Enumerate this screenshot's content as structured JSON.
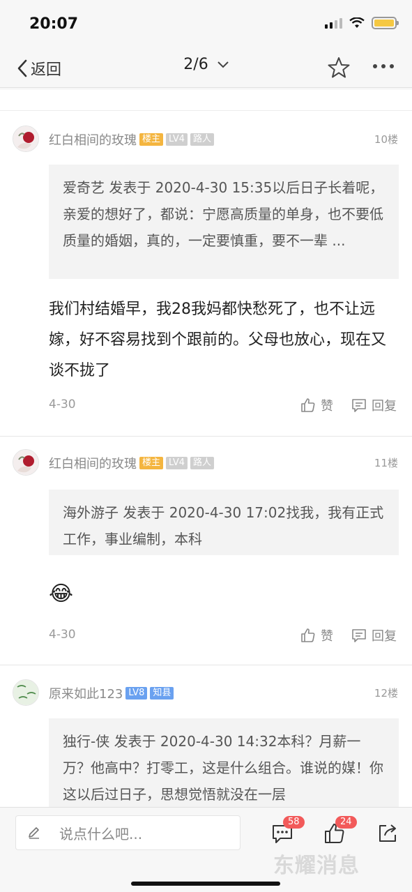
{
  "status": {
    "time": "20:07"
  },
  "nav": {
    "back_label": "返回",
    "page_indicator": "2/6"
  },
  "posts": [
    {
      "author": "红白相间的玫瑰",
      "badges": [
        "楼主",
        "LV4",
        "路人"
      ],
      "floor": "10楼",
      "quote": "爱奇艺 发表于 2020-4-30 15:35以后日子长着呢，亲爱的想好了，都说：宁愿高质量的单身，也不要低质量的婚姻，真的，一定要慎重，要不一辈 ...",
      "content": "我们村结婚早，我28我妈都快愁死了，也不让远嫁，好不容易找到个跟前的。父母也放心，现在又谈不拢了",
      "date": "4-30",
      "like_label": "赞",
      "reply_label": "回复"
    },
    {
      "author": "红白相间的玫瑰",
      "badges": [
        "楼主",
        "LV4",
        "路人"
      ],
      "floor": "11楼",
      "quote": "海外游子 发表于 2020-4-30 17:02找我，我有正式工作，事业编制，本科",
      "content": "😂",
      "date": "4-30",
      "like_label": "赞",
      "reply_label": "回复"
    },
    {
      "author": "原来如此123",
      "badges": [
        "LV8",
        "知县"
      ],
      "floor": "12楼",
      "quote": "独行-侠 发表于 2020-4-30 14:32本科？月薪一万？他高中？打零工，这是什么组合。谁说的媒！你这以后过日子，思想觉悟就没在一层"
    }
  ],
  "bottom": {
    "input_placeholder": "说点什么吧...",
    "comment_count": "58",
    "like_count": "24",
    "watermark": "东耀消息"
  },
  "colors": {
    "host_badge": "#f4b53f",
    "level_badge_blue": "#6aa1f0",
    "count_badge": "#f25a5a"
  },
  "icons": [
    "back-chevron-icon",
    "dropdown-chevron-icon",
    "star-icon",
    "more-icon",
    "thumbs-up-icon",
    "reply-icon",
    "pencil-icon",
    "comment-icon",
    "share-icon"
  ]
}
